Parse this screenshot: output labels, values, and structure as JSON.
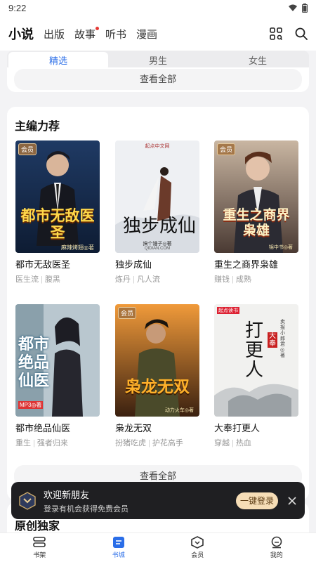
{
  "status": {
    "time": "9:22"
  },
  "top_nav": {
    "tabs": [
      {
        "label": "小说",
        "active": true
      },
      {
        "label": "出版"
      },
      {
        "label": "故事",
        "dot": true
      },
      {
        "label": "听书"
      },
      {
        "label": "漫画"
      }
    ]
  },
  "gender_tabs": [
    {
      "label": "精选",
      "active": true
    },
    {
      "label": "男生"
    },
    {
      "label": "女生"
    }
  ],
  "prev_section": {
    "see_all": "查看全部"
  },
  "section": {
    "title": "主编力荐",
    "see_all": "查看全部",
    "books": [
      {
        "title": "都市无敌医圣",
        "tags": [
          "医生流",
          "腹黑"
        ],
        "vip": "会员",
        "cover_text": "都市无敌医圣",
        "cover_author": "麻辣烤翅◎著"
      },
      {
        "title": "独步成仙",
        "tags": [
          "炼丹",
          "凡人流"
        ],
        "cover_text": "独步成仙",
        "cover_top": "起点中文网",
        "cover_author": "搞个锤子◎著",
        "cover_site": "QIDIAN.COM"
      },
      {
        "title": "重生之商界枭雄",
        "tags": [
          "赚钱",
          "成熟"
        ],
        "vip": "会员",
        "cover_text": "重生之商界枭雄",
        "cover_author": "锦中书◎著"
      },
      {
        "title": "都市绝品仙医",
        "tags": [
          "重生",
          "强者归来"
        ],
        "cover_text": "都市绝品仙医",
        "cover_badge": "MP3◎著"
      },
      {
        "title": "枭龙无双",
        "tags": [
          "扮猪吃虎",
          "护花高手"
        ],
        "vip": "会员",
        "cover_text": "枭龙无双",
        "cover_author": "动力火车◎著"
      },
      {
        "title": "大奉打更人",
        "tags": [
          "穿越",
          "热血"
        ],
        "cover_text": "打更人",
        "cover_top": "起点读书",
        "cover_mark": "大奉",
        "cover_author": "卖报小郎君◎著"
      }
    ]
  },
  "next_section": {
    "title": "原创独家"
  },
  "toast": {
    "title": "欢迎新朋友",
    "subtitle": "登录有机会获得免费会员",
    "login": "一键登录"
  },
  "bottom_bar": [
    {
      "label": "书架",
      "icon": "bookshelf-icon"
    },
    {
      "label": "书城",
      "icon": "bookstore-icon",
      "active": true
    },
    {
      "label": "会员",
      "icon": "vip-icon"
    },
    {
      "label": "我的",
      "icon": "profile-icon"
    }
  ],
  "colors": {
    "accent": "#2b6ee8",
    "badge_dot": "#e53935",
    "toast_bg": "#1f1f22",
    "login_btn": "#f6ddb6"
  }
}
